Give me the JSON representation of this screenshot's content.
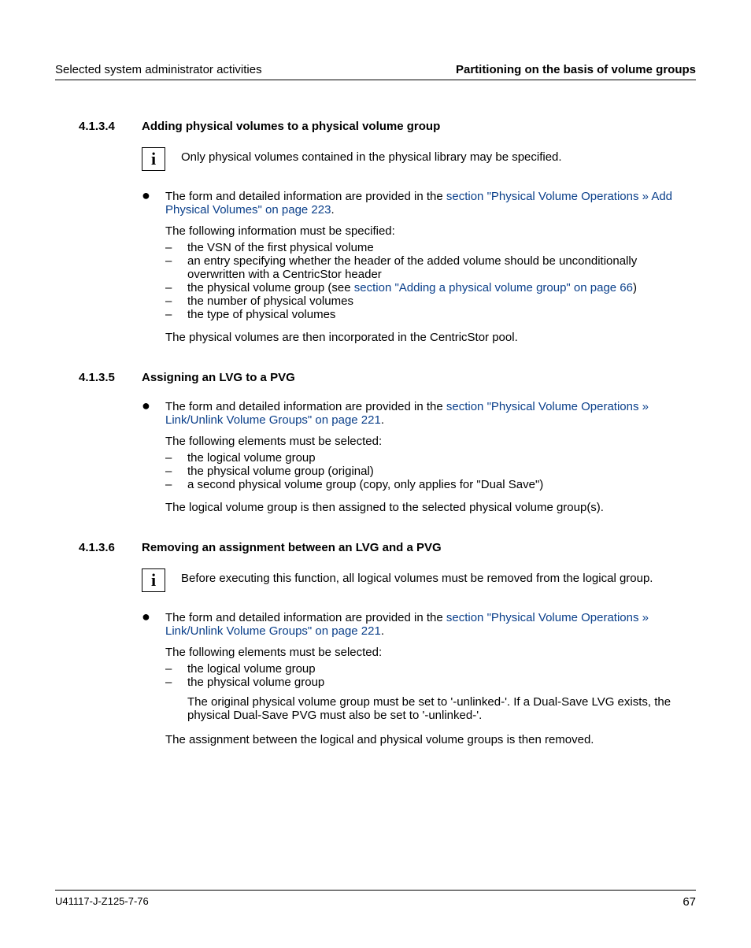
{
  "header": {
    "left": "Selected system administrator activities",
    "right": "Partitioning on the basis of volume groups"
  },
  "sec1": {
    "num": "4.1.3.4",
    "title": "Adding physical volumes to a physical volume group",
    "note": "Only physical volumes contained in the physical library may be specified.",
    "bullet_pre": "The form and detailed information are provided in the ",
    "bullet_link": "section \"Physical Volume Operations » Add Physical Volumes\" on page 223",
    "following": "The following information must be specified:",
    "d1": "the VSN of the first physical volume",
    "d2": "an entry specifying whether the header of the added volume should be unconditionally overwritten with a CentricStor header",
    "d3_pre": "the physical volume group (see ",
    "d3_link": "section \"Adding a physical volume group\" on page 66",
    "d3_post": ")",
    "d4": "the number of physical volumes",
    "d5": "the type of physical volumes",
    "closing": "The physical volumes are then incorporated in the CentricStor pool."
  },
  "sec2": {
    "num": "4.1.3.5",
    "title": "Assigning an LVG to a PVG",
    "bullet_pre": "The form and detailed information are provided in the ",
    "bullet_link": "section \"Physical Volume Operations » Link/Unlink Volume Groups\" on page 221",
    "following": "The following elements must be selected:",
    "d1": "the logical volume group",
    "d2": "the physical volume group (original)",
    "d3": "a second physical volume group (copy, only applies for \"Dual Save\")",
    "closing": "The logical volume group is then assigned to the selected physical volume group(s)."
  },
  "sec3": {
    "num": "4.1.3.6",
    "title": "Removing an assignment between an LVG and a PVG",
    "note": "Before executing this function, all logical volumes must be removed from the logical group.",
    "bullet_pre": "The form and detailed information are provided in the ",
    "bullet_link": "section \"Physical Volume Operations » Link/Unlink Volume Groups\" on page 221",
    "following": "The following elements must be selected:",
    "d1": "the logical volume group",
    "d2": "the physical volume group",
    "d2_sub": "The original physical volume group must be set to '-unlinked-'. If a Dual-Save LVG exists, the physical Dual-Save PVG must also be set to '-unlinked-'.",
    "closing": "The assignment between the logical and physical volume groups is then removed."
  },
  "footer": {
    "left": "U41117-J-Z125-7-76",
    "right": "67"
  },
  "glyph": {
    "info": "i",
    "bullet": "●",
    "dash": "–",
    "period": "."
  }
}
